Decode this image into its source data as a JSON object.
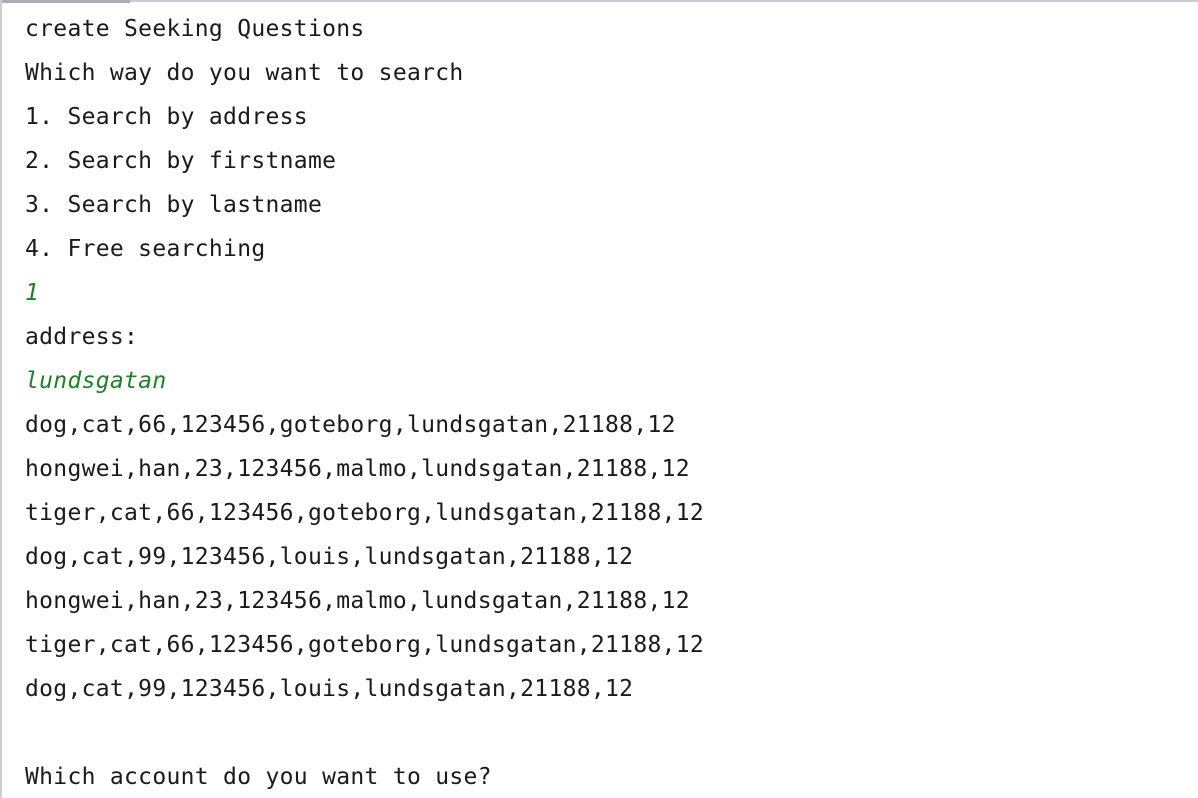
{
  "console": {
    "lines": [
      {
        "text": "create Seeking Questions",
        "kind": "output"
      },
      {
        "text": "Which way do you want to search",
        "kind": "output"
      },
      {
        "text": "1. Search by address",
        "kind": "output"
      },
      {
        "text": "2. Search by firstname",
        "kind": "output"
      },
      {
        "text": "3. Search by lastname",
        "kind": "output"
      },
      {
        "text": "4. Free searching",
        "kind": "output"
      },
      {
        "text": "1",
        "kind": "input"
      },
      {
        "text": "address:",
        "kind": "output"
      },
      {
        "text": "lundsgatan",
        "kind": "input"
      },
      {
        "text": "dog,cat,66,123456,goteborg,lundsgatan,21188,12",
        "kind": "output"
      },
      {
        "text": "hongwei,han,23,123456,malmo,lundsgatan,21188,12",
        "kind": "output"
      },
      {
        "text": "tiger,cat,66,123456,goteborg,lundsgatan,21188,12",
        "kind": "output"
      },
      {
        "text": "dog,cat,99,123456,louis,lundsgatan,21188,12",
        "kind": "output"
      },
      {
        "text": "hongwei,han,23,123456,malmo,lundsgatan,21188,12",
        "kind": "output"
      },
      {
        "text": "tiger,cat,66,123456,goteborg,lundsgatan,21188,12",
        "kind": "output"
      },
      {
        "text": "dog,cat,99,123456,louis,lundsgatan,21188,12",
        "kind": "output"
      },
      {
        "text": "",
        "kind": "blank"
      },
      {
        "text": "Which account do you want to use?",
        "kind": "output"
      }
    ],
    "colors": {
      "output_text": "#1a1a1a",
      "input_text": "#1e7f27",
      "background": "#ffffff"
    }
  }
}
